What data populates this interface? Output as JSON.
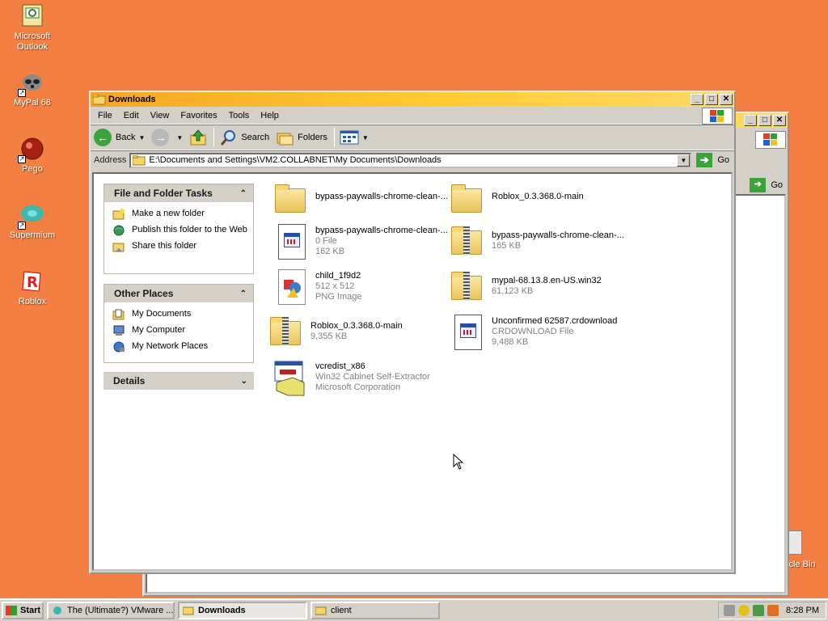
{
  "desktop": {
    "icons": [
      {
        "label": "Microsoft Outlook",
        "icon": "outlook-icon"
      },
      {
        "label": "MyPal 68",
        "icon": "mypal-icon"
      },
      {
        "label": "Pego",
        "icon": "pego-icon"
      },
      {
        "label": "Supermium",
        "icon": "supermium-icon"
      },
      {
        "label": "Roblox",
        "icon": "roblox-icon"
      }
    ],
    "recycle_bin_label": "cle Bin"
  },
  "back_window": {
    "go_label": "Go"
  },
  "window": {
    "title": "Downloads",
    "menu": [
      "File",
      "Edit",
      "View",
      "Favorites",
      "Tools",
      "Help"
    ],
    "toolbar": {
      "back": "Back",
      "search": "Search",
      "folders": "Folders"
    },
    "address": {
      "label": "Address",
      "value": "E:\\Documents and Settings\\VM2.COLLABNET\\My Documents\\Downloads",
      "go": "Go"
    },
    "panes": {
      "tasks": {
        "title": "File and Folder Tasks",
        "items": [
          "Make a new folder",
          "Publish this folder to the Web",
          "Share this folder"
        ]
      },
      "other": {
        "title": "Other Places",
        "items": [
          "My Documents",
          "My Computer",
          "My Network Places"
        ]
      },
      "details": {
        "title": "Details"
      }
    },
    "files": [
      {
        "name": "bypass-paywalls-chrome-clean-...",
        "line2": "",
        "line3": "",
        "kind": "folder"
      },
      {
        "name": "Roblox_0.3.368.0-main",
        "line2": "",
        "line3": "",
        "kind": "folder"
      },
      {
        "name": "bypass-paywalls-chrome-clean-...",
        "line2": "0 File",
        "line3": "162 KB",
        "kind": "doc"
      },
      {
        "name": "bypass-paywalls-chrome-clean-...",
        "line2": "165 KB",
        "line3": "",
        "kind": "zip"
      },
      {
        "name": "child_1f9d2",
        "line2": "512 x 512",
        "line3": "PNG Image",
        "kind": "png"
      },
      {
        "name": "mypal-68.13.8.en-US.win32",
        "line2": "61,123 KB",
        "line3": "",
        "kind": "zip"
      },
      {
        "name": "Roblox_0.3.368.0-main",
        "line2": "9,355 KB",
        "line3": "",
        "kind": "zip"
      },
      {
        "name": "Unconfirmed 62587.crdownload",
        "line2": "CRDOWNLOAD File",
        "line3": "9,488 KB",
        "kind": "doc"
      },
      {
        "name": "vcredist_x86",
        "line2": "Win32 Cabinet Self-Extractor",
        "line3": "Microsoft Corporation",
        "kind": "installer"
      }
    ]
  },
  "taskbar": {
    "start": "Start",
    "buttons": [
      "The (Ultimate?) VMware ...",
      "Downloads",
      "client"
    ],
    "clock": "8:28 PM"
  }
}
